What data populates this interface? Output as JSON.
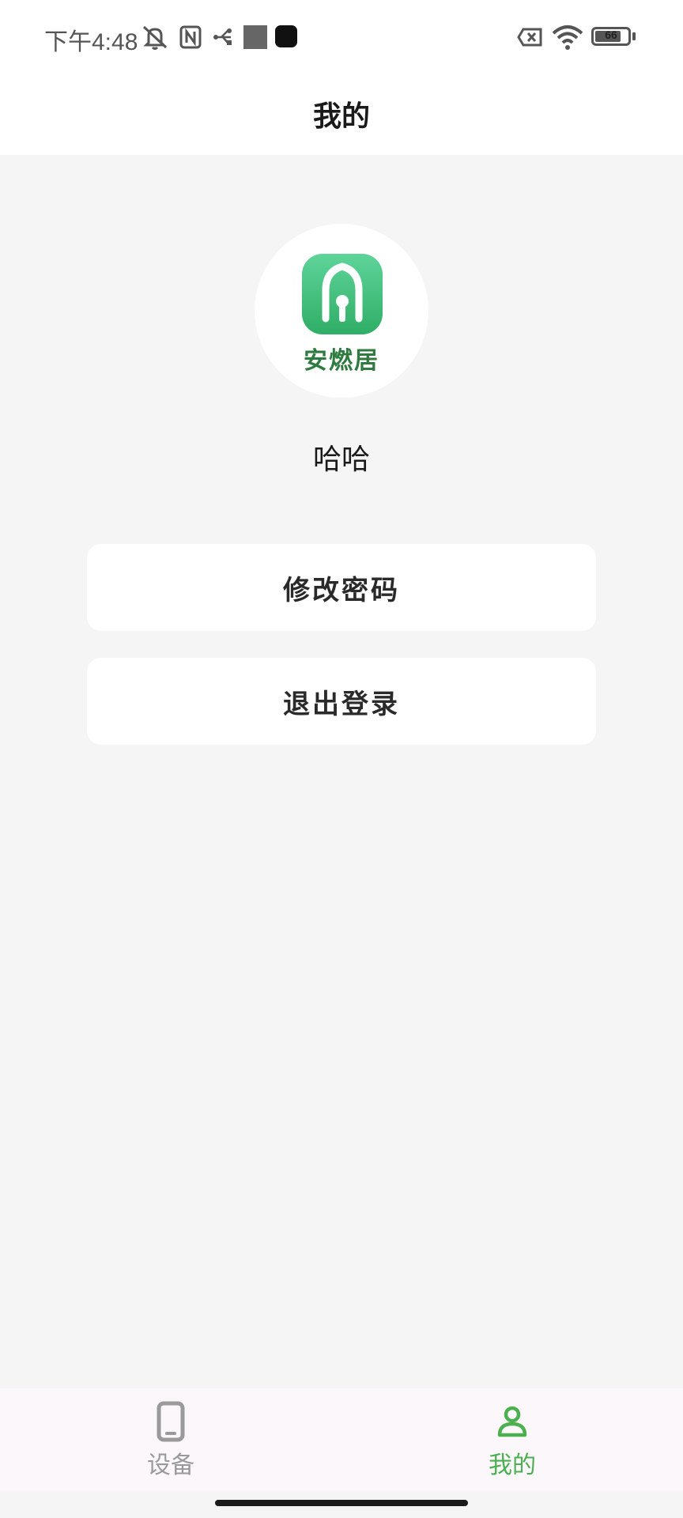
{
  "status_bar": {
    "time": "下午4:48",
    "battery": "66"
  },
  "header": {
    "title": "我的"
  },
  "profile": {
    "logo_text": "安燃居",
    "username": "哈哈"
  },
  "actions": {
    "change_password": "修改密码",
    "logout": "退出登录"
  },
  "bottom_nav": {
    "devices_label": "设备",
    "mine_label": "我的"
  },
  "colors": {
    "accent": "#4caf50",
    "logo_green": "#3dbb77",
    "logo_text": "#2f7a3e",
    "background": "#f5f5f5"
  },
  "icons": [
    "mute-icon",
    "nfc-icon",
    "usb-icon",
    "no-sim-icon",
    "wifi-icon",
    "battery-icon",
    "phone-icon",
    "person-icon"
  ]
}
